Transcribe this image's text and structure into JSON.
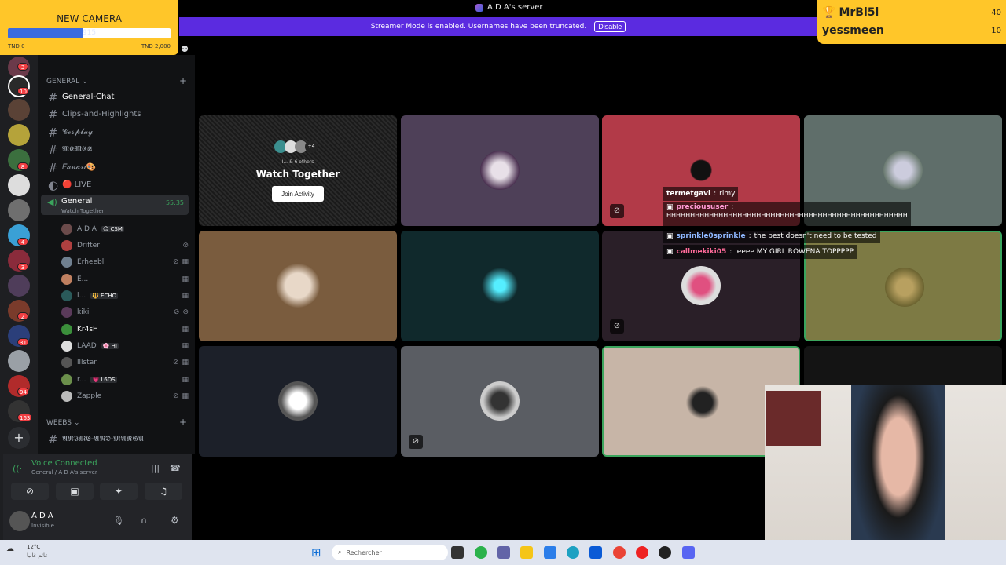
{
  "window": {
    "title": "A D A's server"
  },
  "banner": {
    "text": "Streamer Mode is enabled. Usernames have been truncated.",
    "button": "Disable"
  },
  "goal": {
    "title": "NEW CAMERA",
    "current": 915,
    "min_label": "TND 0",
    "max_label": "TND 2,000",
    "progress": 0.4575,
    "bar_color": "#3b6be0"
  },
  "leaderboard": [
    {
      "name": "MrBi5i",
      "count": "40",
      "icon": "trophy-icon"
    },
    {
      "name": "yessmeen",
      "count": "10"
    }
  ],
  "rail_badges": [
    "3",
    "10",
    "8",
    "3",
    "4",
    "2",
    "31",
    "94",
    "163"
  ],
  "channels": {
    "general_category": "GENERAL",
    "items": [
      "General-Chat",
      "Clips-and-Highlights",
      "𝓒𝓸𝓼𝓹𝓵𝓪𝔂",
      "𝕸𝕰𝕸𝕰𝕾",
      "𝐹𝒶𝓃𝒶𝓇𝓉🎨",
      "🔴 LIVE"
    ],
    "voice": {
      "name": "General",
      "sub": "Watch Together",
      "time": "55:35"
    },
    "voice_users": [
      {
        "name": "A D A",
        "tag": "😊 CSM"
      },
      {
        "name": "Drifter"
      },
      {
        "name": "Erheebl"
      },
      {
        "name": "E..."
      },
      {
        "name": "i...",
        "tag": "🔱 ECHO"
      },
      {
        "name": "kiki"
      },
      {
        "name": "Kr4sH"
      },
      {
        "name": "LAAD",
        "tag": "🌸 HI"
      },
      {
        "name": "lllstar"
      },
      {
        "name": "r...",
        "tag": "💗 L6DS"
      },
      {
        "name": "Zapple"
      }
    ],
    "weebs_category": "WEEBS",
    "weebs_channel": "𝕬𝕹𝕴𝕸𝕰-𝕬𝕹𝕯-𝕸𝕬𝕹𝕲𝕬"
  },
  "voice_panel": {
    "status": "Voice Connected",
    "location": "General / A D A's server",
    "user": "A D A",
    "user_status": "Invisible"
  },
  "activity": {
    "others": "I... & 6 others",
    "count": "+4",
    "title": "Watch Together",
    "button": "Join Activity"
  },
  "chat": [
    {
      "user": "termetgavi",
      "text": "rimy",
      "color": "#ffffff"
    },
    {
      "user": "precioususer",
      "text": "HHHHHHHHHHHHHHHHHHHHHHHHHHHHHHHHHHHHHHHHHHHHHHHHHHH",
      "color": "#ff9ad5"
    },
    {
      "user": "sprinkle0sprinkle",
      "text": "the best doesn't need to be tested",
      "color": "#8fb8ff"
    },
    {
      "user": "callmekiki05",
      "text": "leeee MY GIRL ROWENA TOPPPPP",
      "color": "#ff6b9a"
    }
  ],
  "weather": {
    "temp": "12°C",
    "desc": "غائم غالبا"
  },
  "taskbar": {
    "search_placeholder": "Rechercher"
  }
}
